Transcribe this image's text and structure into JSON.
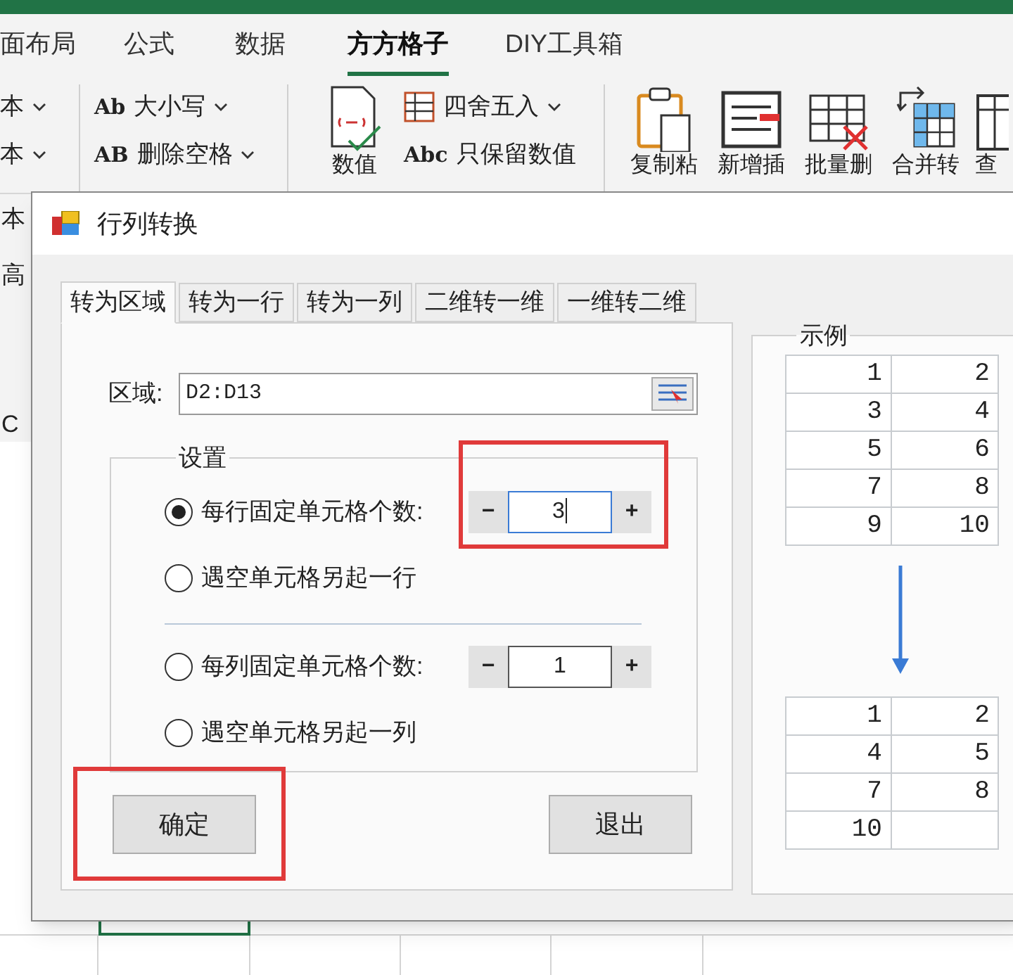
{
  "ribbon_tabs": [
    {
      "label": "面布局",
      "selected": false
    },
    {
      "label": "公式",
      "selected": false
    },
    {
      "label": "数据",
      "selected": false
    },
    {
      "label": "方方格子",
      "selected": true
    },
    {
      "label": "DIY工具箱",
      "selected": false
    }
  ],
  "ribbon_groups": [
    {
      "items": [
        {
          "kind": "small",
          "label": "本",
          "dropdown": true
        },
        {
          "kind": "small",
          "label": "本",
          "dropdown": true
        }
      ]
    },
    {
      "items": [
        {
          "kind": "small",
          "icon_text": "Ab",
          "label": "大小写",
          "dropdown": true
        },
        {
          "kind": "small",
          "icon_text": "AB",
          "label": "删除空格",
          "dropdown": true
        }
      ]
    },
    {
      "items": [
        {
          "kind": "large",
          "label": "数值"
        },
        {
          "kind": "small",
          "label": "四舍五入",
          "dropdown": true
        },
        {
          "kind": "small",
          "icon_text": "Abc",
          "label": "只保留数值",
          "dropdown": false
        }
      ]
    },
    {
      "items": [
        {
          "kind": "large",
          "label": "复制粘"
        },
        {
          "kind": "large",
          "label": "新增插"
        },
        {
          "kind": "large",
          "label": "批量删"
        },
        {
          "kind": "large",
          "label": "合并转"
        },
        {
          "kind": "large",
          "label": "查"
        }
      ]
    }
  ],
  "left_strip": [
    "本",
    "高",
    "C"
  ],
  "dialog": {
    "title": "行列转换",
    "tabs": [
      {
        "label": "转为区域",
        "selected": true
      },
      {
        "label": "转为一行",
        "selected": false
      },
      {
        "label": "转为一列",
        "selected": false
      },
      {
        "label": "二维转一维",
        "selected": false
      },
      {
        "label": "一维转二维",
        "selected": false
      }
    ],
    "range_label": "区域:",
    "range_value": "D2:D13",
    "settings_title": "设置",
    "options": [
      {
        "kind": "spinner",
        "label": "每行固定单元格个数:",
        "selected": true,
        "value": "3",
        "focused": true,
        "minus": "−",
        "plus": "+"
      },
      {
        "kind": "plain",
        "label": "遇空单元格另起一行",
        "selected": false
      },
      {
        "kind": "divider"
      },
      {
        "kind": "spinner",
        "label": "每列固定单元格个数:",
        "selected": false,
        "value": "1",
        "focused": false,
        "minus": "−",
        "plus": "+"
      },
      {
        "kind": "plain",
        "label": "遇空单元格另起一列",
        "selected": false
      }
    ],
    "buttons": [
      "确定",
      "退出"
    ],
    "example": {
      "title": "示例",
      "before": [
        [
          "1",
          "2"
        ],
        [
          "3",
          "4"
        ],
        [
          "5",
          "6"
        ],
        [
          "7",
          "8"
        ],
        [
          "9",
          "10"
        ]
      ],
      "after": [
        [
          "1",
          "2"
        ],
        [
          "4",
          "5"
        ],
        [
          "7",
          "8"
        ],
        [
          "10"
        ]
      ]
    }
  }
}
